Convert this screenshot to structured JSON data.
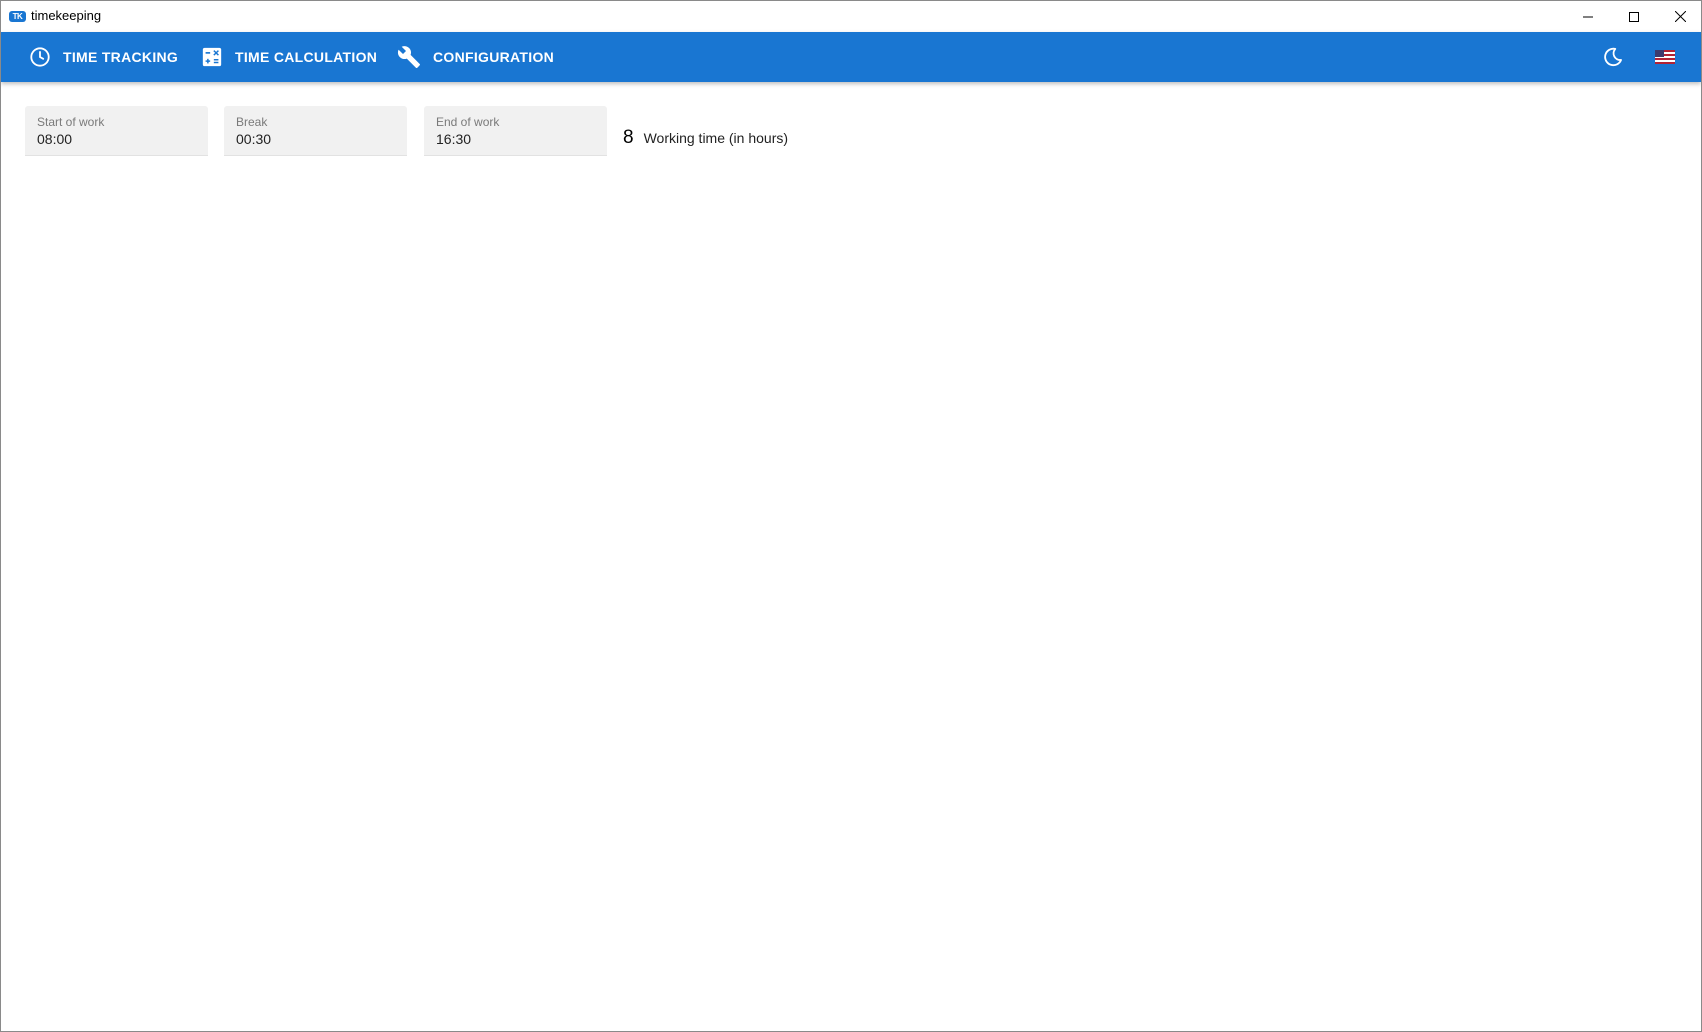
{
  "window": {
    "title": "timekeeping",
    "icon_text": "TK",
    "icon": "app-logo-icon",
    "controls": {
      "minimize": "minimize-icon",
      "maximize": "maximize-icon",
      "close": "close-icon"
    }
  },
  "appbar": {
    "color": "#1976d2",
    "nav": [
      {
        "label": "TIME TRACKING",
        "icon": "clock-icon"
      },
      {
        "label": "TIME CALCULATION",
        "icon": "calculator-icon"
      },
      {
        "label": "CONFIGURATION",
        "icon": "wrench-icon"
      }
    ],
    "theme_toggle_icon": "moon-icon",
    "language_icon": "us-flag-icon"
  },
  "form": {
    "start": {
      "label": "Start of work",
      "value": "08:00"
    },
    "break": {
      "label": "Break",
      "value": "00:30"
    },
    "end": {
      "label": "End of work",
      "value": "16:30"
    }
  },
  "result": {
    "value": "8",
    "label": "Working time (in hours)"
  }
}
